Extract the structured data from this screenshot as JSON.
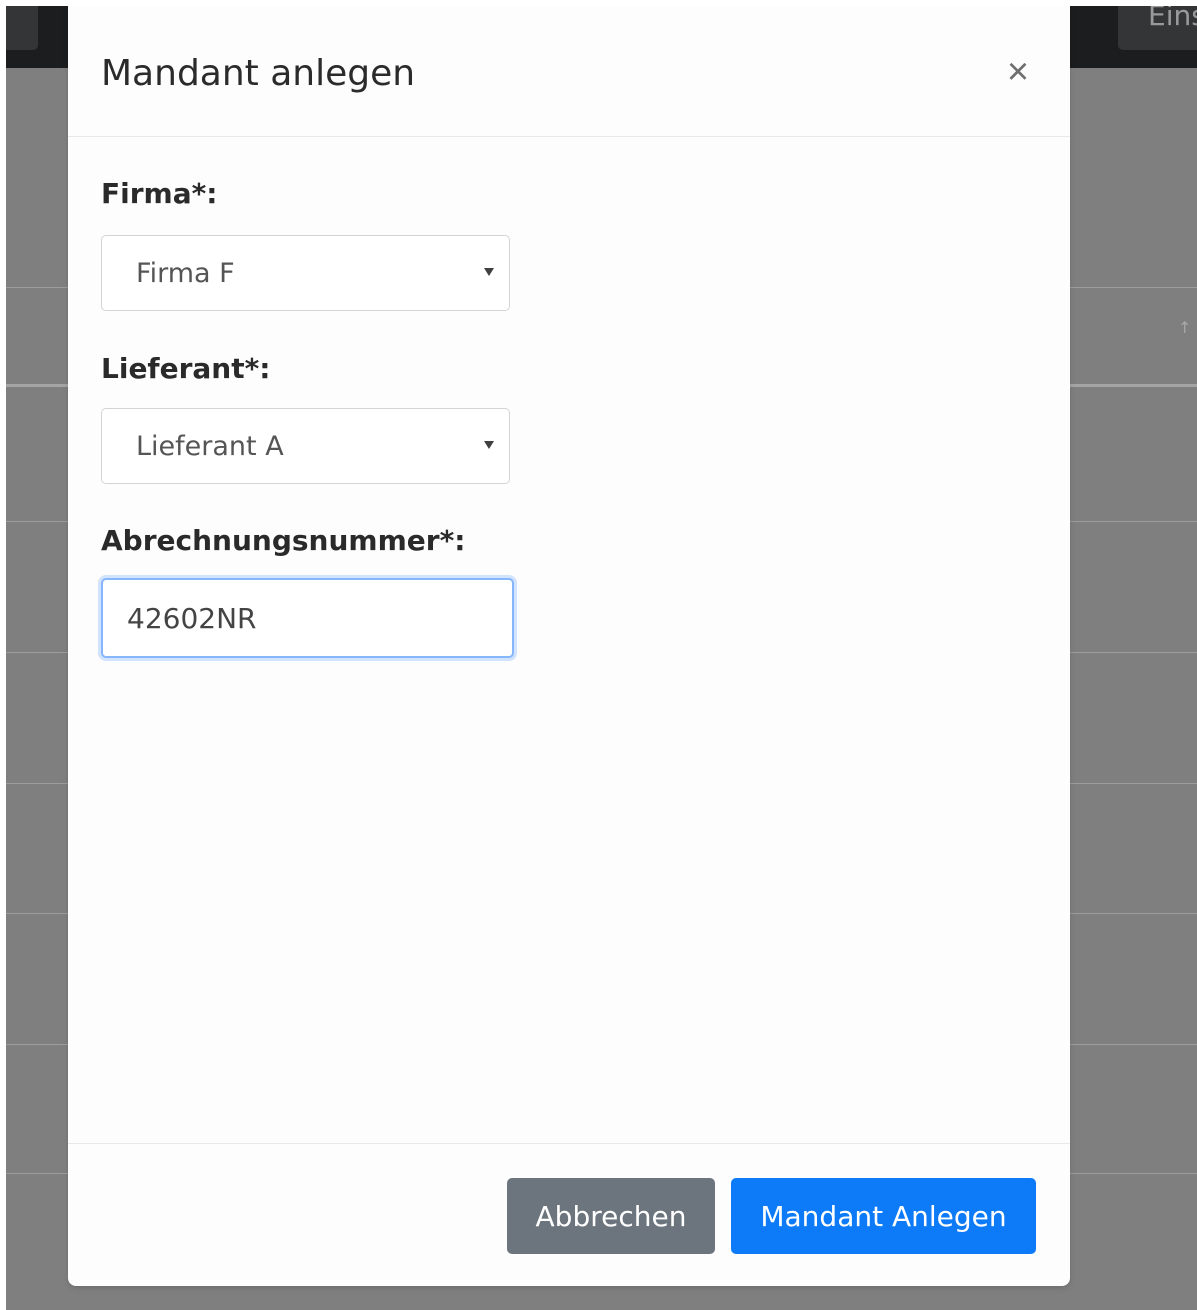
{
  "background": {
    "nav_right_label": "Eins"
  },
  "modal": {
    "title": "Mandant anlegen",
    "close_label": "×",
    "fields": {
      "firma": {
        "label": "Firma*:",
        "value": "Firma F"
      },
      "lieferant": {
        "label": "Lieferant*:",
        "value": "Lieferant A"
      },
      "abrechnungsnummer": {
        "label": "Abrechnungsnummer*:",
        "value": "42602NR"
      }
    },
    "buttons": {
      "cancel_label": "Abbrechen",
      "submit_label": "Mandant Anlegen"
    }
  },
  "colors": {
    "primary": "#0d7bf7",
    "secondary": "#6c757d",
    "backdrop": "#7f7f7f",
    "navbar": "#1b1d1f",
    "focus_ring": "#86b7fe"
  }
}
